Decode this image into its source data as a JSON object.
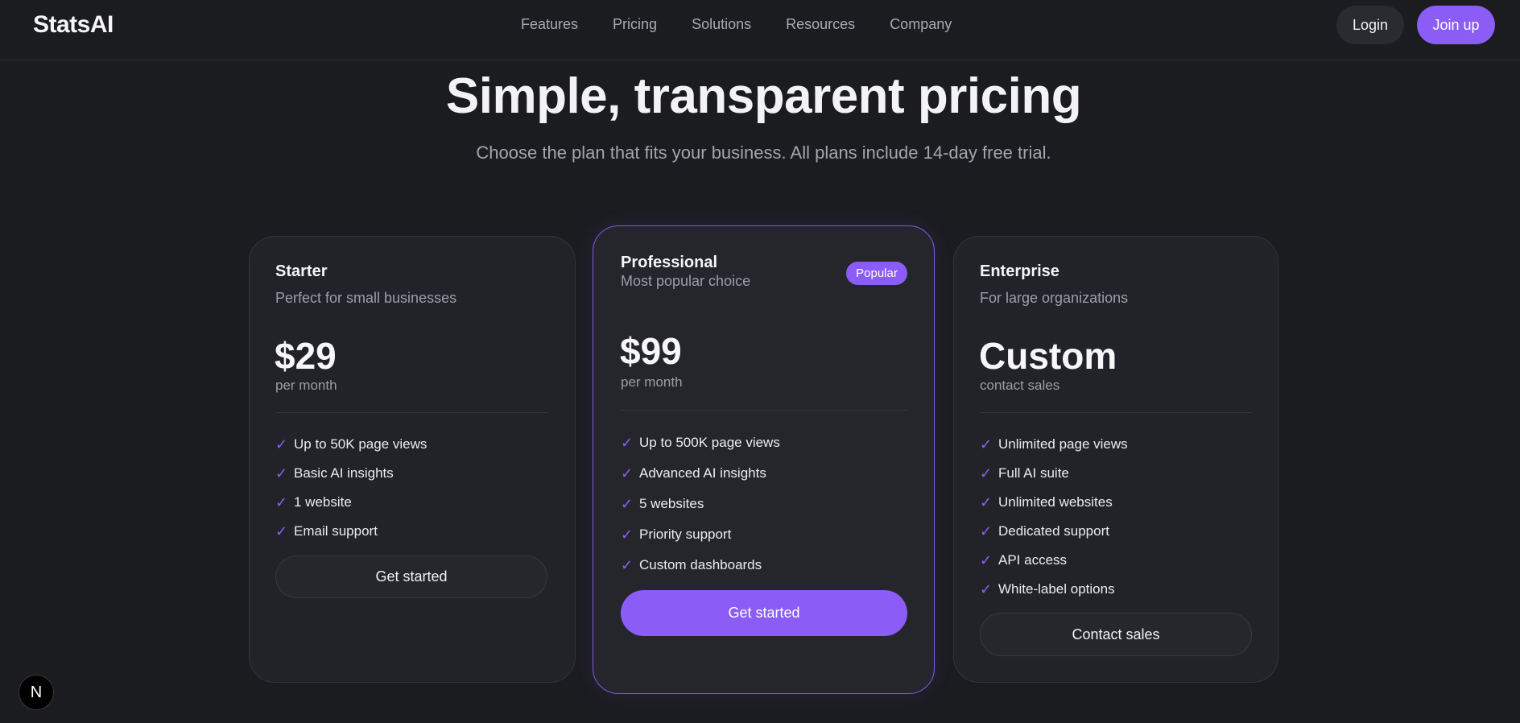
{
  "header": {
    "logo": "StatsAI",
    "nav": [
      "Features",
      "Pricing",
      "Solutions",
      "Resources",
      "Company"
    ],
    "login_label": "Login",
    "join_label": "Join up"
  },
  "hero": {
    "title": "Simple, transparent pricing",
    "subtitle": "Choose the plan that fits your business. All plans include 14-day free trial."
  },
  "plans": [
    {
      "name": "Starter",
      "description": "Perfect for small businesses",
      "price": "$29",
      "period": "per month",
      "features": [
        "Up to 50K page views",
        "Basic AI insights",
        "1 website",
        "Email support"
      ],
      "cta": "Get started"
    },
    {
      "name": "Professional",
      "description": "Most popular choice",
      "badge": "Popular",
      "price": "$99",
      "period": "per month",
      "features": [
        "Up to 500K page views",
        "Advanced AI insights",
        "5 websites",
        "Priority support",
        "Custom dashboards"
      ],
      "cta": "Get started"
    },
    {
      "name": "Enterprise",
      "description": "For large organizations",
      "price": "Custom",
      "period": "contact sales",
      "features": [
        "Unlimited page views",
        "Full AI suite",
        "Unlimited websites",
        "Dedicated support",
        "API access",
        "White-label options"
      ],
      "cta": "Contact sales"
    }
  ],
  "check_icon": "✓",
  "dev_badge": "N",
  "colors": {
    "background": "#1b1c20",
    "accent": "#8b5cf6",
    "card": "#222328"
  }
}
